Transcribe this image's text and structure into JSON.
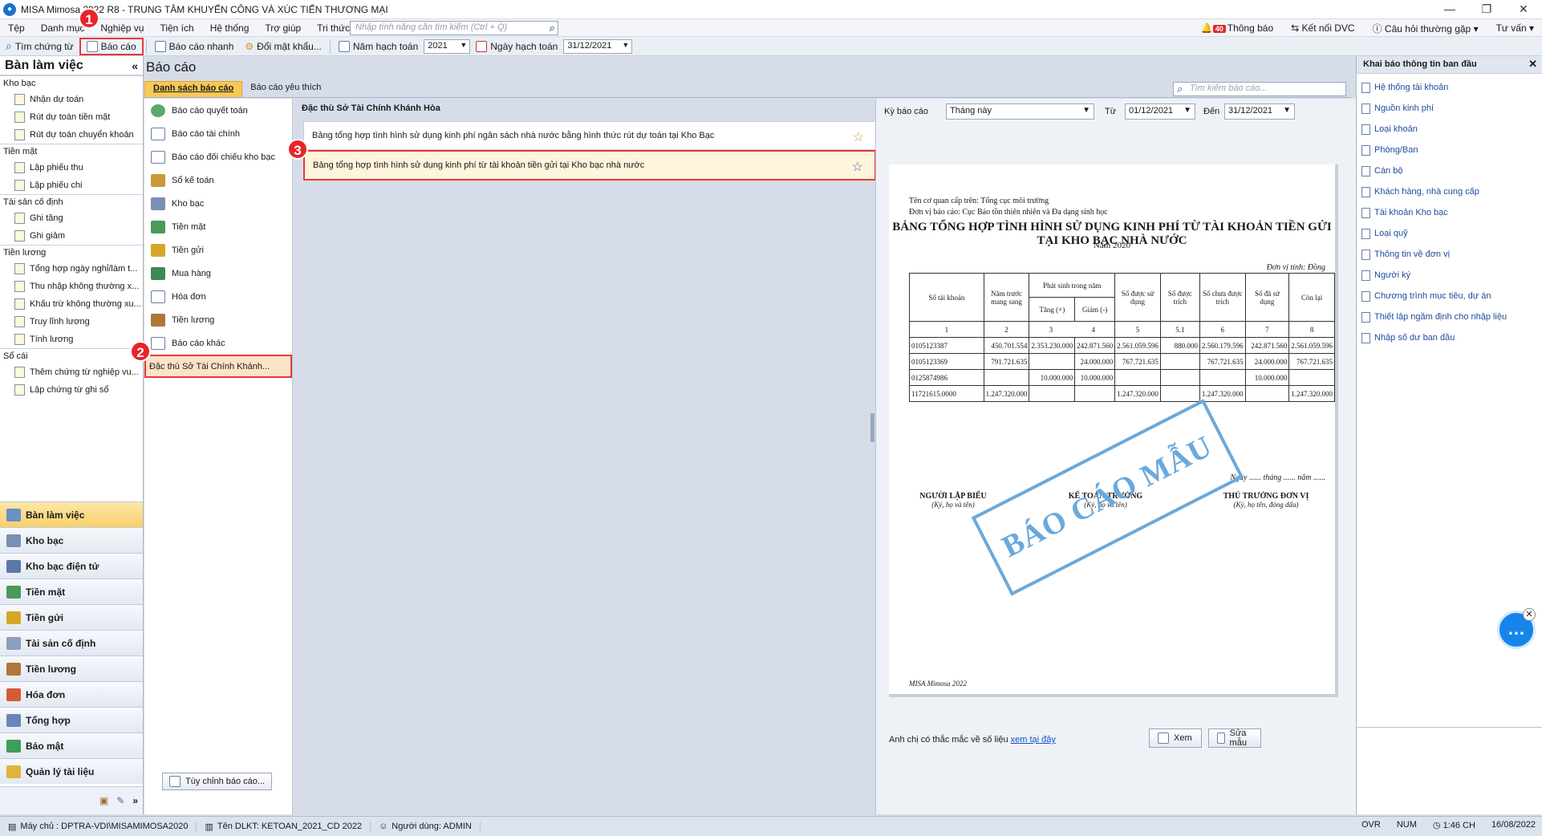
{
  "window": {
    "title": "MISA Mimosa 2022 R8 - TRUNG TÂM KHUYẾN CÔNG VÀ XÚC TIẾN THƯƠNG MẠI",
    "logo": "misa-logo"
  },
  "menu": {
    "items": [
      "Tệp",
      "Danh mục",
      "Nghiệp vụ",
      "Tiện ích",
      "Hệ thống",
      "Trợ giúp",
      "Tri thức"
    ],
    "search_placeholder": "Nhập tính năng cần tìm kiếm (Ctrl + Q)",
    "notifications_count": "40",
    "notifications_label": "Thông báo",
    "connect_label": "Kết nối DVC",
    "faq_label": "Câu hỏi thường gặp",
    "advice_label": "Tư vấn"
  },
  "toolbar": {
    "find_voucher": "Tìm chứng từ",
    "report": "Báo cáo",
    "quick_report": "Báo cáo nhanh",
    "change_password": "Đổi mật khẩu...",
    "fiscal_year_label": "Năm hạch toán",
    "fiscal_year_value": "2021",
    "accounting_date_label": "Ngày hạch toán",
    "accounting_date_value": "31/12/2021"
  },
  "annotations": [
    "1",
    "2",
    "3"
  ],
  "left_panel": {
    "title": "Bàn làm việc",
    "groups": [
      {
        "name": "Kho bạc",
        "items": [
          "Nhận dự toán",
          "Rút dự toán tiền mặt",
          "Rút dự toán chuyển khoản"
        ]
      },
      {
        "name": "Tiền mặt",
        "items": [
          "Lập phiếu thu",
          "Lập phiếu chi"
        ]
      },
      {
        "name": "Tài sản cố định",
        "items": [
          "Ghi tăng",
          "Ghi giảm"
        ]
      },
      {
        "name": "Tiền lương",
        "items": [
          "Tổng hợp ngày nghỉ/làm t...",
          "Thu nhập không thường x...",
          "Khấu trừ không thường xu...",
          "Truy lĩnh lương",
          "Tính lương"
        ]
      },
      {
        "name": "Sổ cái",
        "items": [
          "Thêm chứng từ nghiệp vu...",
          "Lập chứng từ ghi sổ"
        ]
      }
    ],
    "modules": [
      "Bàn làm việc",
      "Kho bạc",
      "Kho bạc điện tử",
      "Tiền mặt",
      "Tiền gửi",
      "Tài sản cố định",
      "Tiền lương",
      "Hóa đơn",
      "Tổng hợp",
      "Báo mật",
      "Quản lý tài liệu"
    ]
  },
  "reports": {
    "title": "Báo cáo",
    "tabs": [
      "Danh sách báo cáo",
      "Báo cáo yêu thích"
    ],
    "search_placeholder": "Tìm kiếm báo cáo...",
    "categories": [
      "Báo cáo quyết toán",
      "Báo cáo tài chính",
      "Báo cáo đối chiếu kho bạc",
      "Sổ kế toán",
      "Kho bạc",
      "Tiền mặt",
      "Tiền gửi",
      "Mua hàng",
      "Hóa đơn",
      "Tiền lương",
      "Báo cáo khác",
      "Đặc thù Sở Tài Chính Khánh..."
    ],
    "customize_button": "Tùy chỉnh báo cáo...",
    "list_title": "Đặc thù Sở Tài Chính Khánh Hòa",
    "list": [
      "Bảng tổng hợp tình hình sử dụng kinh phí ngân sách nhà nước bằng hình thức rút dự toán tại Kho Bạc",
      "Bảng tổng hợp tình hình sử dụng kinh phí từ tài khoản tiền gửi tại Kho bạc nhà nước"
    ]
  },
  "preview": {
    "period_label": "Kỳ báo cáo",
    "period_value": "Tháng này",
    "from_label": "Từ",
    "from_value": "01/12/2021",
    "to_label": "Đến",
    "to_value": "31/12/2021",
    "paper": {
      "superior": "Tên cơ quan cấp trên: Tổng cục môi trường",
      "unit": "Đơn vị báo cáo: Cục Bảo tồn thiên nhiên và Đa dạng sinh học",
      "title": "BẢNG TỔNG HỢP TÌNH HÌNH SỬ DỤNG KINH PHÍ TỪ TÀI KHOẢN TIỀN GỬI TẠI KHO BẠC NHÀ NƯỚC",
      "year": "Năm 2020",
      "currency": "Đơn vị tính: Đồng",
      "headers": {
        "account": "Số tài khoản",
        "prev_year": "Năm trước mang sang",
        "arising": "Phát sinh trong năm",
        "increase": "Tăng (+)",
        "decrease": "Giảm (-)",
        "usable": "Số được sử dụng",
        "deducted": "Số được trích",
        "not_deducted": "Số chưa được trích",
        "used": "Số đã sử dụng",
        "remaining": "Còn lại"
      },
      "col_numbers": [
        "1",
        "2",
        "3",
        "4",
        "5",
        "5.1",
        "6",
        "7",
        "8"
      ],
      "rows": [
        [
          "0105123387",
          "450.701.554",
          "2.353.230.000",
          "242.871.560",
          "2.561.059.596",
          "880.000",
          "2.560.179.596",
          "242.871.560",
          "2.561.059.596"
        ],
        [
          "0105123369",
          "791.721.635",
          "",
          "24.000.000",
          "767.721.635",
          "",
          "767.721.635",
          "24.000.000",
          "767.721.635"
        ],
        [
          "0125874986",
          "",
          "10.000.000",
          "10.000.000",
          "",
          "",
          "",
          "10.000.000",
          ""
        ],
        [
          "11721615.0000",
          "1.247.320.000",
          "",
          "",
          "1.247.320.000",
          "",
          "1.247.320.000",
          "",
          "1.247.320.000"
        ]
      ],
      "date_line": "Ngày ...... tháng ...... năm ......",
      "sign_preparer": "NGƯỜI LẬP BIỂU",
      "sign_preparer_note": "(Ký, họ và tên)",
      "sign_accountant": "KẾ TOÁN TRƯỞNG",
      "sign_accountant_note": "(Ký, họ và tên)",
      "sign_head": "THỦ TRƯỞNG ĐƠN VỊ",
      "sign_head_note": "(Ký, họ tên, đóng dấu)",
      "stamp": "BÁO CÁO MẪU",
      "footer": "MISA Mimosa 2022"
    },
    "question_text": "Anh chị có thắc mắc về số liệu",
    "question_link": "xem tại đây",
    "view_button": "Xem",
    "edit_button": "Sửa mẫu"
  },
  "right_panel": {
    "title": "Khai báo thông tin ban đầu",
    "items": [
      "Hệ thống tài khoản",
      "Nguồn kinh phí",
      "Loại khoản",
      "Phòng/Ban",
      "Cán bộ",
      "Khách hàng, nhà cung cấp",
      "Tài khoản Kho bạc",
      "Loại quỹ",
      "Thông tin về đơn vị",
      "Người ký",
      "Chương trình mục tiêu, dự án",
      "Thiết lập ngầm định cho nhập liệu",
      "Nhập số dư ban đầu"
    ]
  },
  "status": {
    "server": "Máy chủ : DPTRA-VDI\\MISAMIMOSA2020",
    "db": "Tên DLKT: KETOAN_2021_CD 2022",
    "user": "Người dùng: ADMIN",
    "ovr": "OVR",
    "num": "NUM",
    "time": "1:46 CH",
    "date": "16/08/2022"
  }
}
